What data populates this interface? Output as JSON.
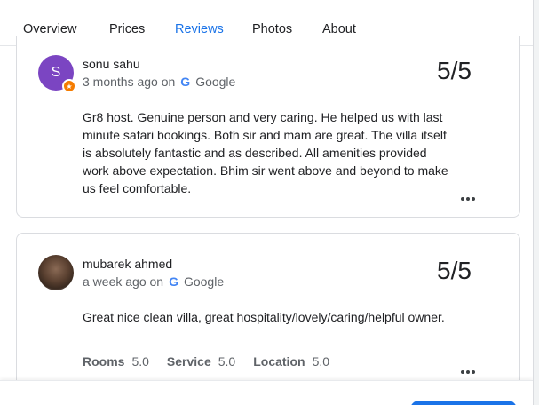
{
  "tabs": [
    {
      "label": "Overview"
    },
    {
      "label": "Prices"
    },
    {
      "label": "Reviews"
    },
    {
      "label": "Photos"
    },
    {
      "label": "About"
    }
  ],
  "active_tab": "Reviews",
  "reviews": [
    {
      "avatar_letter": "S",
      "avatar_color": "#7b45c2",
      "name": "sonu sahu",
      "time": "3 months ago on",
      "source": "Google",
      "score": "5/5",
      "text": "Gr8 host. Genuine person and very caring. He helped us with last minute safari bookings. Both sir and mam are great. The villa itself is absolutely fantastic and as described. All amenities provided work above expectation. Bhim sir went above and beyond to make us feel comfortable."
    },
    {
      "name": "mubarek ahmed",
      "time": "a week ago on",
      "source": "Google",
      "score": "5/5",
      "text": "Great nice clean villa, great hospitality/lovely/caring/helpful owner.",
      "ratings": [
        {
          "label": "Rooms",
          "value": "5.0"
        },
        {
          "label": "Service",
          "value": "5.0"
        },
        {
          "label": "Location",
          "value": "5.0"
        }
      ]
    }
  ],
  "colors": {
    "accent": "#1a73e8",
    "text": "#202124",
    "muted": "#5f6368"
  }
}
